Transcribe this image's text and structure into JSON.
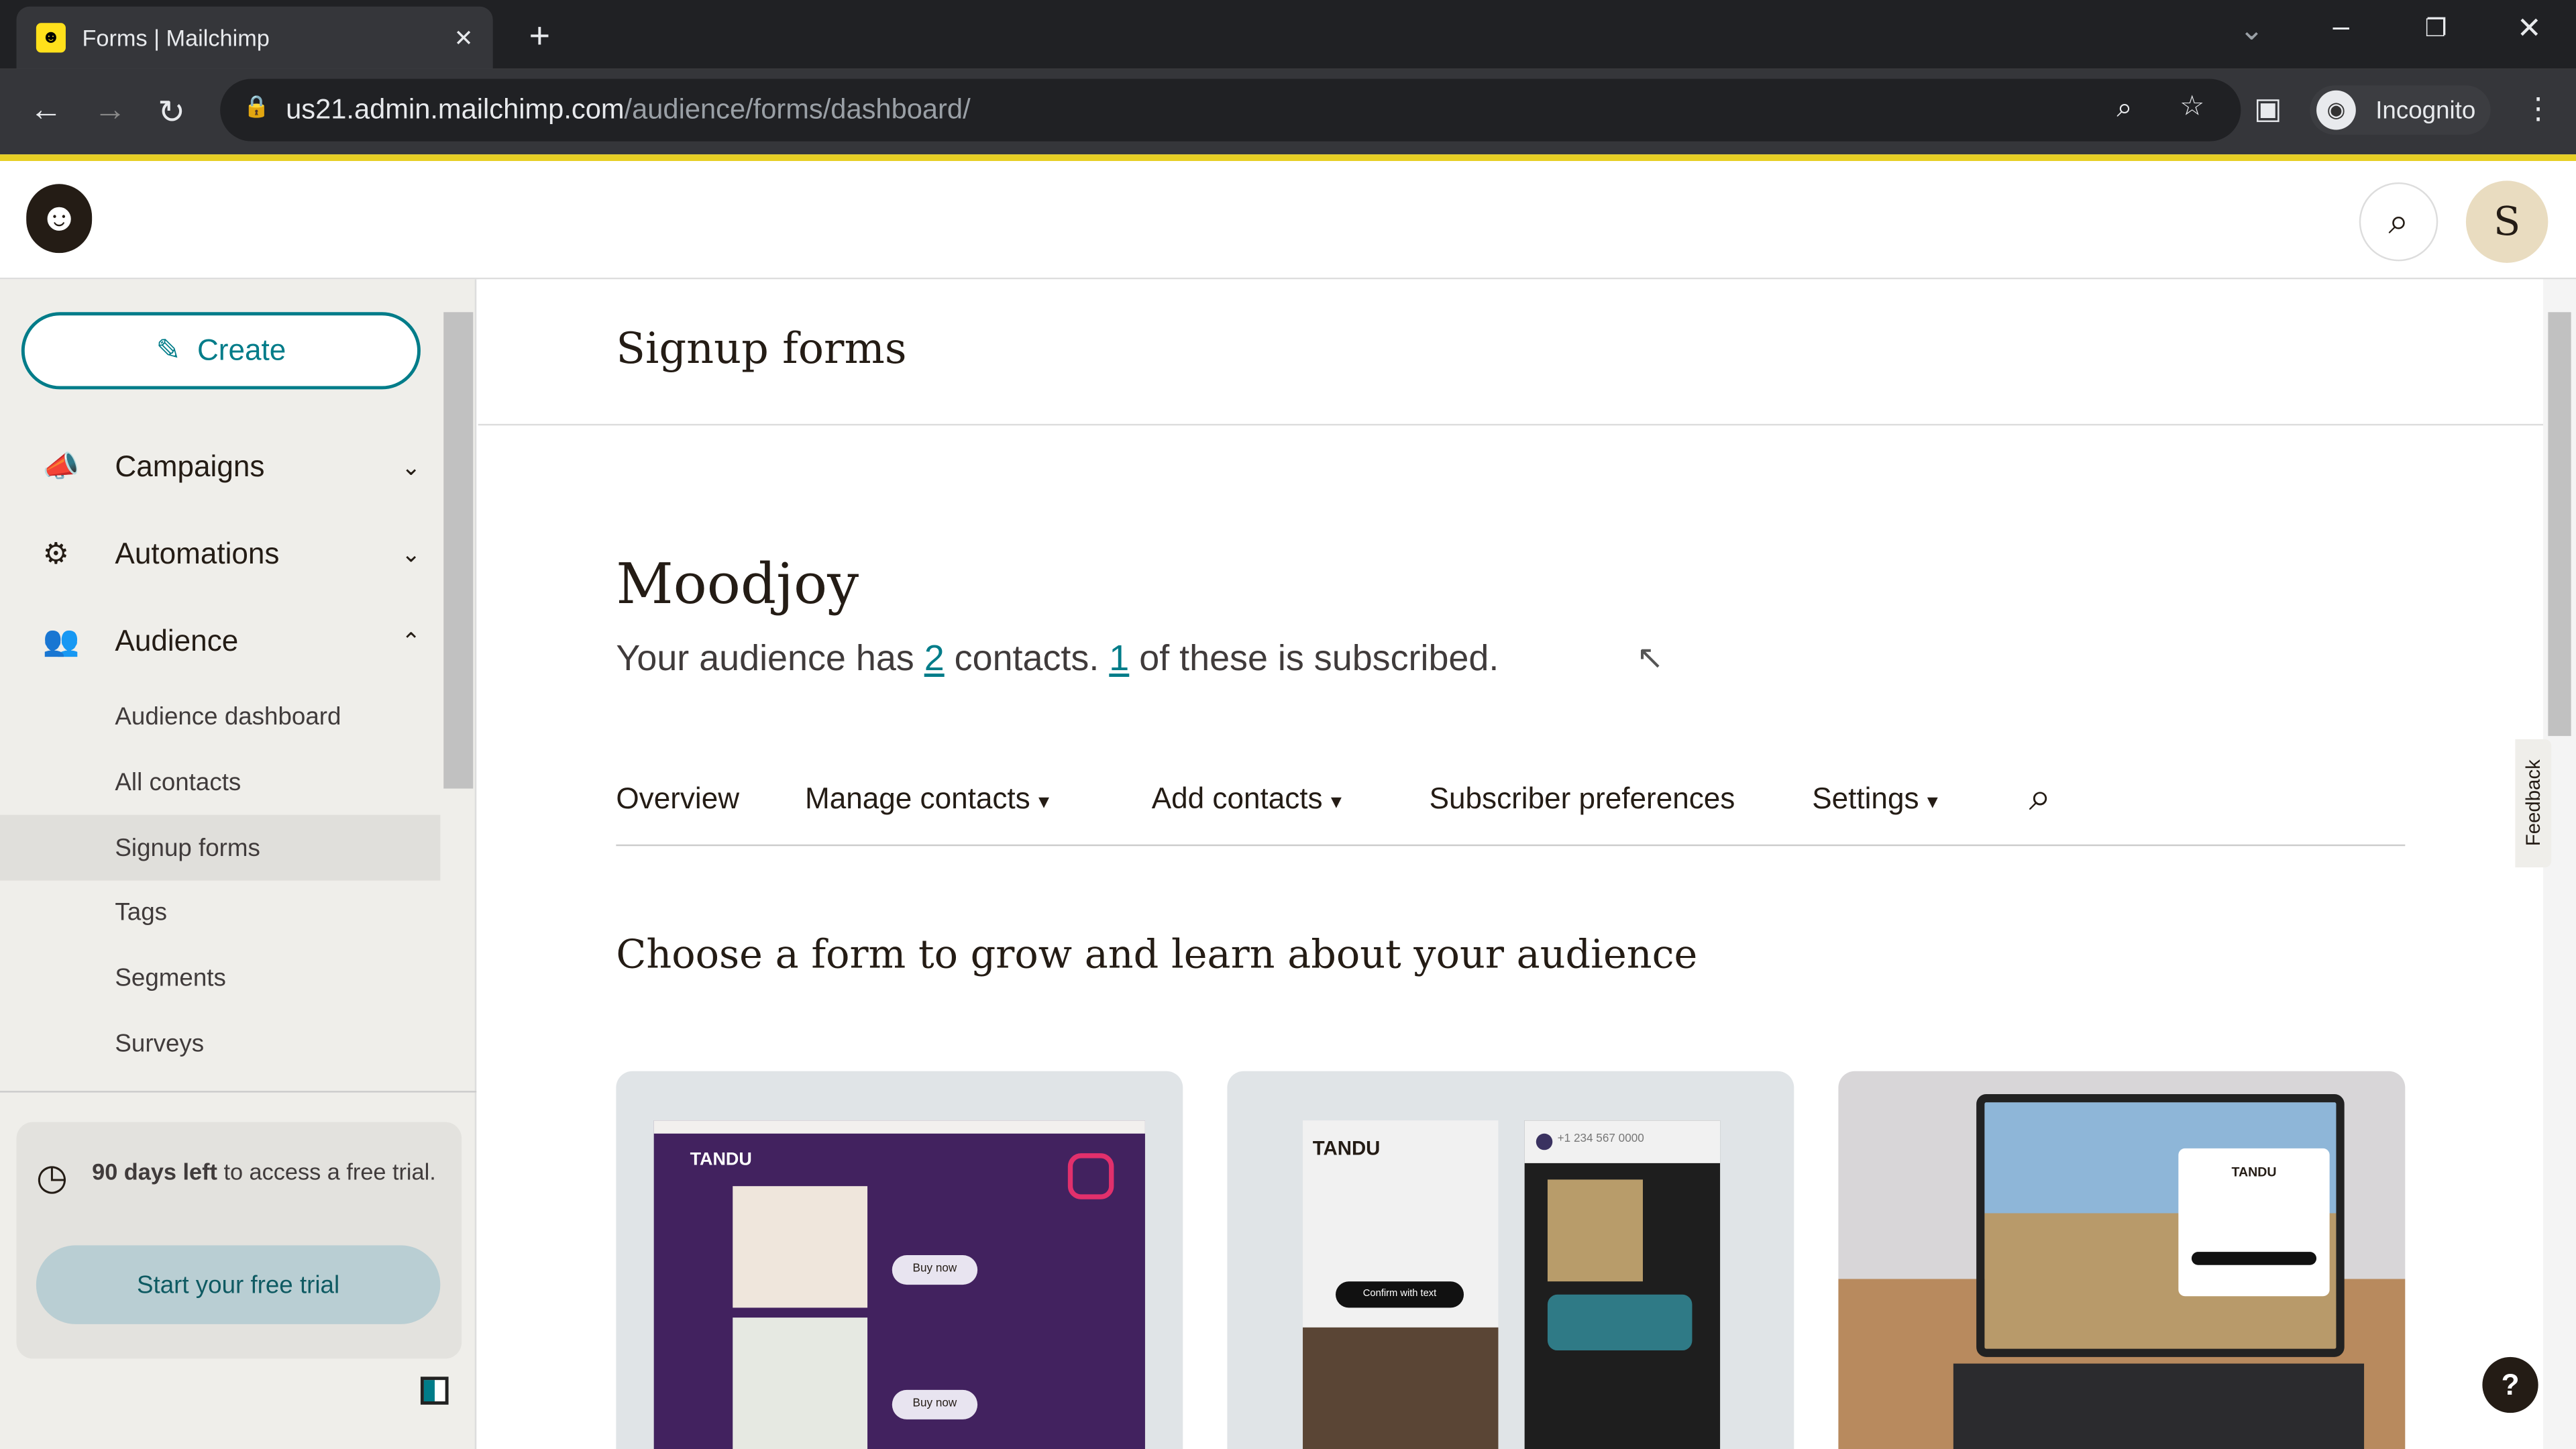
{
  "browser": {
    "tab_title": "Forms | Mailchimp",
    "url_host": "us21.admin.mailchimp.com",
    "url_path": "/audience/forms/dashboard/",
    "profile_label": "Incognito"
  },
  "header": {
    "avatar_initial": "S"
  },
  "sidebar": {
    "create_label": "Create",
    "items": [
      {
        "label": "Campaigns",
        "icon": "megaphone-icon"
      },
      {
        "label": "Automations",
        "icon": "automation-icon"
      },
      {
        "label": "Audience",
        "icon": "audience-icon"
      }
    ],
    "audience_sub": [
      "Audience dashboard",
      "All contacts",
      "Signup forms",
      "Tags",
      "Segments",
      "Surveys"
    ],
    "active_sub": "Signup forms",
    "trial": {
      "bold": "90 days left",
      "text": " to access a free trial.",
      "button": "Start your free trial"
    }
  },
  "main": {
    "page_title": "Signup forms",
    "audience_name": "Moodjoy",
    "summary": {
      "p1": "Your audience has ",
      "contacts": "2",
      "p2": " contacts. ",
      "subscribed": "1",
      "p3": " of these is subscribed."
    },
    "tabs": [
      "Overview",
      "Manage contacts",
      "Add contacts",
      "Subscriber preferences",
      "Settings"
    ],
    "section_title": "Choose a form to grow and learn about your audience",
    "cards": [
      {
        "brand": "TANDU",
        "buttons": [
          "Buy now",
          "Buy now"
        ]
      },
      {
        "brand": "TANDU",
        "phone": "+1 234 567 0000",
        "button": "Confirm with text"
      },
      {
        "brand": "TANDU"
      }
    ],
    "feedback_label": "Feedback",
    "help_label": "?"
  },
  "colors": {
    "accent": "#007c89",
    "brand_yellow": "#ffe01b"
  }
}
